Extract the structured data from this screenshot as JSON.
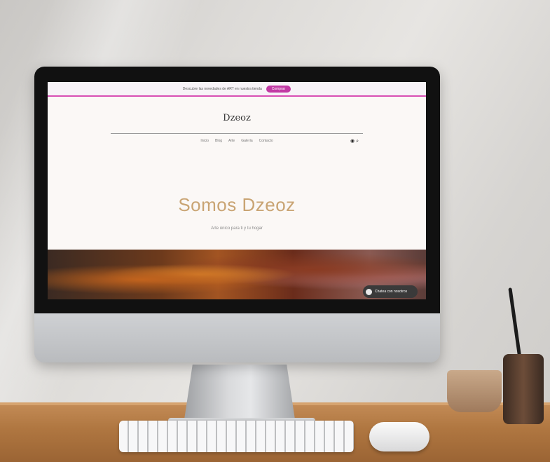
{
  "website": {
    "announcement": {
      "text": "Descubre las novedades de ART en nuestra tienda",
      "cta": "Comprar"
    },
    "logo": "Dzeoz",
    "nav_items": [
      "Inicio",
      "Blog",
      "Arte",
      "Galería",
      "Contacto"
    ],
    "nav_icons": [
      "person-icon",
      "search-icon"
    ],
    "hero": {
      "title": "Somos Dzeoz",
      "subtitle": "Arte único para ti y tu hogar"
    },
    "chat_button": "Chatea con nosotros"
  }
}
